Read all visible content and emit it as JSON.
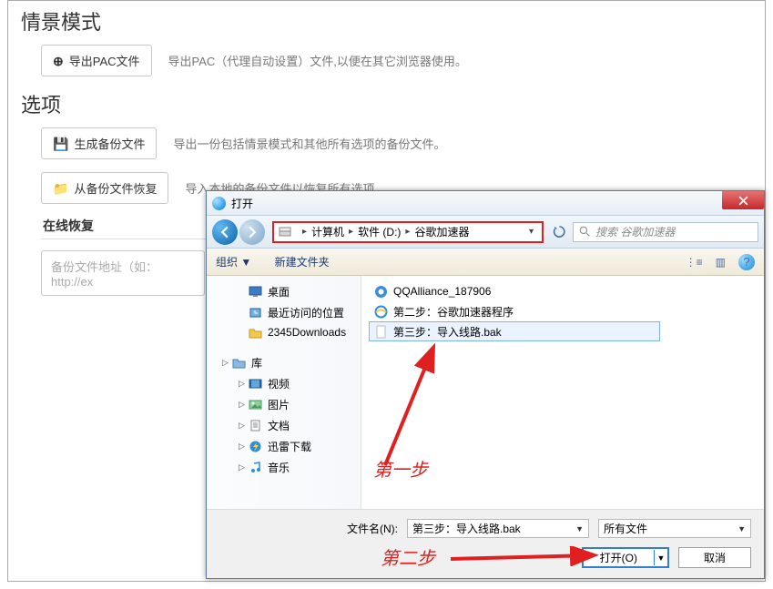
{
  "sections": {
    "scene_mode_heading": "情景模式",
    "options_heading": "选项",
    "export_pac_label": "导出PAC文件",
    "export_pac_desc": "导出PAC（代理自动设置）文件,以便在其它浏览器使用。",
    "gen_backup_label": "生成备份文件",
    "gen_backup_desc": "导出一份包括情景模式和其他所有选项的备份文件。",
    "restore_local_label": "从备份文件恢复",
    "restore_local_desc": "导入本地的备份文件以恢复所有选项。",
    "restore_online_label": "在线恢复",
    "restore_online_placeholder": "备份文件地址（如：http://ex"
  },
  "dialog": {
    "title": "打开",
    "breadcrumb": [
      "计算机",
      "软件 (D:)",
      "谷歌加速器"
    ],
    "search_placeholder": "搜索 谷歌加速器",
    "toolbar_organize": "组织 ▼",
    "toolbar_newfolder": "新建文件夹",
    "view_icon": "⋮≡",
    "layout_icon": "▥",
    "help_icon": "?",
    "tree": [
      {
        "icon": "desktop",
        "label": "桌面",
        "indent": true,
        "caret": ""
      },
      {
        "icon": "recent",
        "label": "最近访问的位置",
        "indent": true,
        "caret": ""
      },
      {
        "icon": "folder",
        "label": "2345Downloads",
        "indent": true,
        "caret": ""
      },
      {
        "icon": "library",
        "label": "库",
        "indent": false,
        "caret": "▷"
      },
      {
        "icon": "video",
        "label": "视频",
        "indent": true,
        "caret": "▷"
      },
      {
        "icon": "picture",
        "label": "图片",
        "indent": true,
        "caret": "▷"
      },
      {
        "icon": "document",
        "label": "文档",
        "indent": true,
        "caret": "▷"
      },
      {
        "icon": "thunder",
        "label": "迅雷下载",
        "indent": true,
        "caret": "▷"
      },
      {
        "icon": "music",
        "label": "音乐",
        "indent": true,
        "caret": "▷"
      }
    ],
    "files": [
      {
        "icon": "qq",
        "label": "QQAlliance_187906",
        "selected": false
      },
      {
        "icon": "ie",
        "label": "第二步：谷歌加速器程序",
        "selected": false
      },
      {
        "icon": "blank",
        "label": "第三步：导入线路.bak",
        "selected": true
      }
    ],
    "filename_label": "文件名(N):",
    "filename_value": "第三步：导入线路.bak",
    "filter_label": "所有文件",
    "open_btn": "打开(O)",
    "cancel_btn": "取消"
  },
  "annotations": {
    "step1": "第一步",
    "step2": "第二步"
  }
}
